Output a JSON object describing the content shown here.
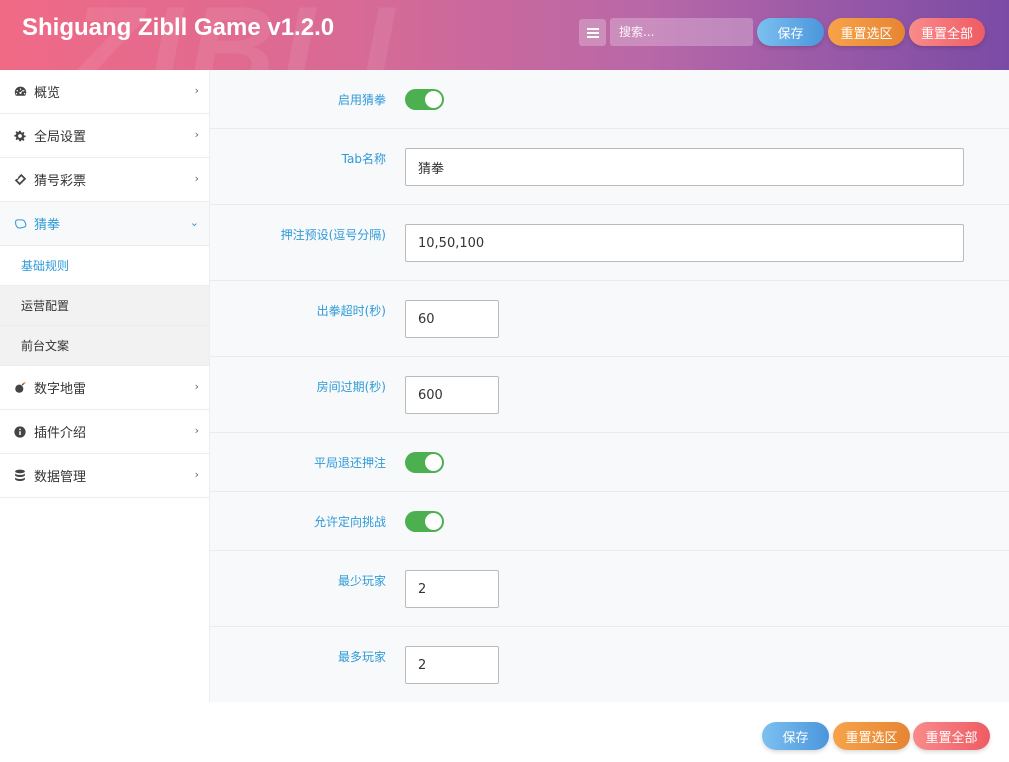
{
  "header": {
    "title": "Shiguang Zibll Game v1.2.0",
    "watermark": "ZIBLL",
    "search_placeholder": "搜索...",
    "save_label": "保存",
    "reset_section_label": "重置选区",
    "reset_all_label": "重置全部"
  },
  "sidebar": {
    "items": [
      {
        "label": "概览",
        "icon": "dashboard-icon"
      },
      {
        "label": "全局设置",
        "icon": "gear-icon"
      },
      {
        "label": "猜号彩票",
        "icon": "ticket-icon"
      },
      {
        "label": "猜拳",
        "icon": "hand-icon",
        "active": true
      },
      {
        "label": "数字地雷",
        "icon": "bomb-icon"
      },
      {
        "label": "插件介绍",
        "icon": "info-icon"
      },
      {
        "label": "数据管理",
        "icon": "database-icon"
      }
    ],
    "sub_items": [
      {
        "label": "基础规则",
        "active": true
      },
      {
        "label": "运营配置"
      },
      {
        "label": "前台文案"
      }
    ]
  },
  "form": {
    "enable_label": "启用猜拳",
    "enable_on": true,
    "tab_name_label": "Tab名称",
    "tab_name_value": "猜拳",
    "bet_presets_label": "押注预设(逗号分隔)",
    "bet_presets_value": "10,50,100",
    "timeout_label": "出拳超时(秒)",
    "timeout_value": "60",
    "room_expire_label": "房间过期(秒)",
    "room_expire_value": "600",
    "draw_refund_label": "平局退还押注",
    "draw_refund_on": true,
    "directed_label": "允许定向挑战",
    "directed_on": true,
    "min_players_label": "最少玩家",
    "min_players_value": "2",
    "max_players_label": "最多玩家",
    "max_players_value": "2"
  },
  "footer": {
    "save_label": "保存",
    "reset_section_label": "重置选区",
    "reset_all_label": "重置全部"
  },
  "colors": {
    "accent": "#2f9bd8",
    "toggle_on": "#4caf50",
    "header_start": "#f06a86",
    "header_end": "#7a4ba6"
  }
}
